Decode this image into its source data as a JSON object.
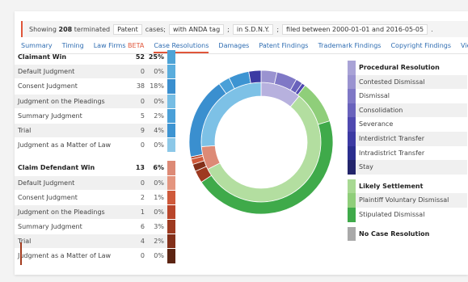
{
  "filter": {
    "showing": "Showing",
    "count": "208",
    "status": "terminated",
    "chips": [
      "Patent",
      "cases;",
      "with ANDA tag",
      ";",
      "in S.D.N.Y.",
      ";",
      "filed between 2000-01-01 and 2016-05-05",
      "."
    ]
  },
  "tabs": [
    {
      "label": "Summary"
    },
    {
      "label": "Timing"
    },
    {
      "label": "Law Firms",
      "badge": "BETA"
    },
    {
      "label": "Case Resolutions",
      "active": true
    },
    {
      "label": "Damages"
    },
    {
      "label": "Patent Findings"
    },
    {
      "label": "Trademark Findings"
    },
    {
      "label": "Copyright Findings"
    },
    {
      "label": "Vie"
    }
  ],
  "claimant": [
    {
      "label": "Claimant Win",
      "count": "52",
      "pct": "25%",
      "color": "#4ea3d6",
      "head": true
    },
    {
      "label": "Default Judgment",
      "count": "0",
      "pct": "0%",
      "color": "#5aaddd"
    },
    {
      "label": "Consent Judgment",
      "count": "38",
      "pct": "18%",
      "color": "#3a8fcf"
    },
    {
      "label": "Judgment on the Pleadings",
      "count": "0",
      "pct": "0%",
      "color": "#76bde4"
    },
    {
      "label": "Summary Judgment",
      "count": "5",
      "pct": "2%",
      "color": "#4aa0d8"
    },
    {
      "label": "Trial",
      "count": "9",
      "pct": "4%",
      "color": "#3d94d2"
    },
    {
      "label": "Judgment as a Matter of Law",
      "count": "0",
      "pct": "0%",
      "color": "#8cc8e8"
    }
  ],
  "defendant": [
    {
      "label": "Claim Defendant Win",
      "count": "13",
      "pct": "6%",
      "color": "#dd8a76",
      "head": true
    },
    {
      "label": "Default Judgment",
      "count": "0",
      "pct": "0%",
      "color": "#e4957f"
    },
    {
      "label": "Consent Judgment",
      "count": "2",
      "pct": "1%",
      "color": "#cf5a3b"
    },
    {
      "label": "Judgment on the Pleadings",
      "count": "1",
      "pct": "0%",
      "color": "#b9452a"
    },
    {
      "label": "Summary Judgment",
      "count": "6",
      "pct": "3%",
      "color": "#9e3a20"
    },
    {
      "label": "Trial",
      "count": "4",
      "pct": "2%",
      "color": "#83301a"
    },
    {
      "label": "Judgment as a Matter of Law",
      "count": "0",
      "pct": "0%",
      "color": "#5c2412"
    }
  ],
  "legend": [
    {
      "label": "Procedural Resolution",
      "color": "#a9a3d6",
      "head": true
    },
    {
      "label": "Contested Dismissal",
      "color": "#9a93d0"
    },
    {
      "label": "Dismissal",
      "color": "#7f78c6"
    },
    {
      "label": "Consolidation",
      "color": "#6962bc"
    },
    {
      "label": "Severance",
      "color": "#4f49b0"
    },
    {
      "label": "Interdistrict Transfer",
      "color": "#3c3aa3"
    },
    {
      "label": "Intradistrict Transfer",
      "color": "#2b2e8f"
    },
    {
      "label": "Stay",
      "color": "#23256b"
    },
    {
      "label": "Likely Settlement",
      "color": "#a8d993",
      "head": true,
      "gap": true
    },
    {
      "label": "Plaintiff Voluntary Dismissal",
      "color": "#8fce7a"
    },
    {
      "label": "Stipulated Dismissal",
      "color": "#3faa4a"
    },
    {
      "label": "No Case Resolution",
      "color": "#a9a9a9",
      "head": true,
      "gap": true
    }
  ],
  "chart_data": {
    "type": "pie",
    "inner": [
      {
        "name": "Procedural Resolution",
        "value": 10.5,
        "color": "#b7b1de"
      },
      {
        "name": "Likely Settlement",
        "value": 54,
        "color": "#b3dea0"
      },
      {
        "name": "Claim Defendant Win",
        "value": 6,
        "color": "#dd8a76"
      },
      {
        "name": "Claimant Win",
        "value": 25,
        "color": "#7dc1e6"
      }
    ],
    "outer": [
      {
        "name": "Contested Dismissal",
        "value": 3.5,
        "color": "#9a93d0"
      },
      {
        "name": "Dismissal",
        "value": 4.5,
        "color": "#7f78c6"
      },
      {
        "name": "Consolidation",
        "value": 1.5,
        "color": "#6962bc"
      },
      {
        "name": "Severance",
        "value": 0.8,
        "color": "#4f49b0"
      },
      {
        "name": "Plaintiff Voluntary Dismissal",
        "value": 9.5,
        "color": "#8fce7a"
      },
      {
        "name": "Stipulated Dismissal",
        "value": 44.5,
        "color": "#3faa4a"
      },
      {
        "name": "Summary Judgment",
        "value": 2.7,
        "color": "#9e3a20"
      },
      {
        "name": "Trial",
        "value": 1.6,
        "color": "#83301a"
      },
      {
        "name": "Consent Judgment",
        "value": 1.2,
        "color": "#cf5a3b"
      },
      {
        "name": "Judgment on the Pleadings",
        "value": 0.5,
        "color": "#b9452a"
      },
      {
        "name": "Consent Judgment",
        "value": 18,
        "color": "#3a8fcf"
      },
      {
        "name": "Summary Judgment",
        "value": 2.5,
        "color": "#4aa0d8"
      },
      {
        "name": "Trial",
        "value": 4.5,
        "color": "#3d94d2"
      },
      {
        "name": "Interdistrict Transfer",
        "value": 2.7,
        "color": "#3c3aa3"
      }
    ]
  }
}
